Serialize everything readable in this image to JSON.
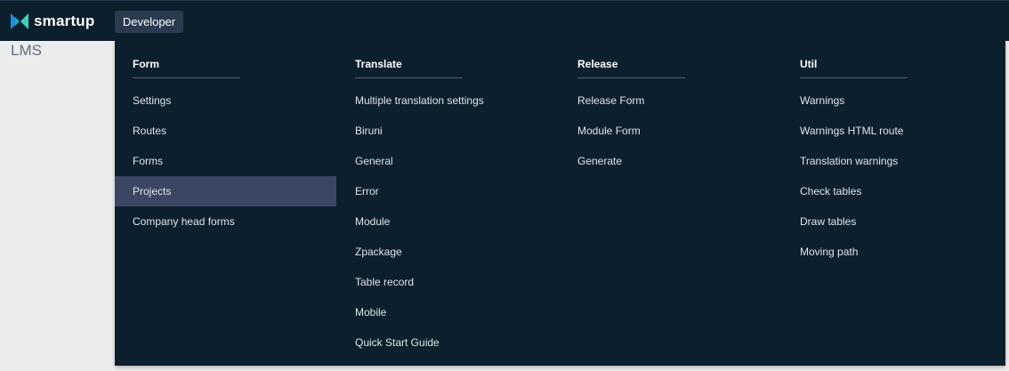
{
  "brand": {
    "name": "smartup"
  },
  "nav": {
    "developer": "Developer"
  },
  "page": {
    "title": "LMS"
  },
  "menu": {
    "columns": [
      {
        "title": "Form",
        "items": [
          "Settings",
          "Routes",
          "Forms",
          "Projects",
          "Company head forms"
        ]
      },
      {
        "title": "Translate",
        "items": [
          "Multiple translation settings",
          "Biruni",
          "General",
          "Error",
          "Module",
          "Zpackage",
          "Table record",
          "Mobile",
          "Quick Start Guide"
        ]
      },
      {
        "title": "Release",
        "items": [
          "Release Form",
          "Module Form",
          "Generate"
        ]
      },
      {
        "title": "Util",
        "items": [
          "Warnings",
          "Warnings HTML route",
          "Translation warnings",
          "Check tables",
          "Draw tables",
          "Moving path"
        ]
      }
    ],
    "active_item": "Projects"
  },
  "colors": {
    "topbar": "#0b1f2c",
    "menu_bg": "#0b1f2c",
    "active_bg": "#3b4564",
    "nav_button_bg": "#2b3a4e",
    "logo_blue": "#1f8fe0",
    "logo_teal": "#3fd1b9"
  }
}
